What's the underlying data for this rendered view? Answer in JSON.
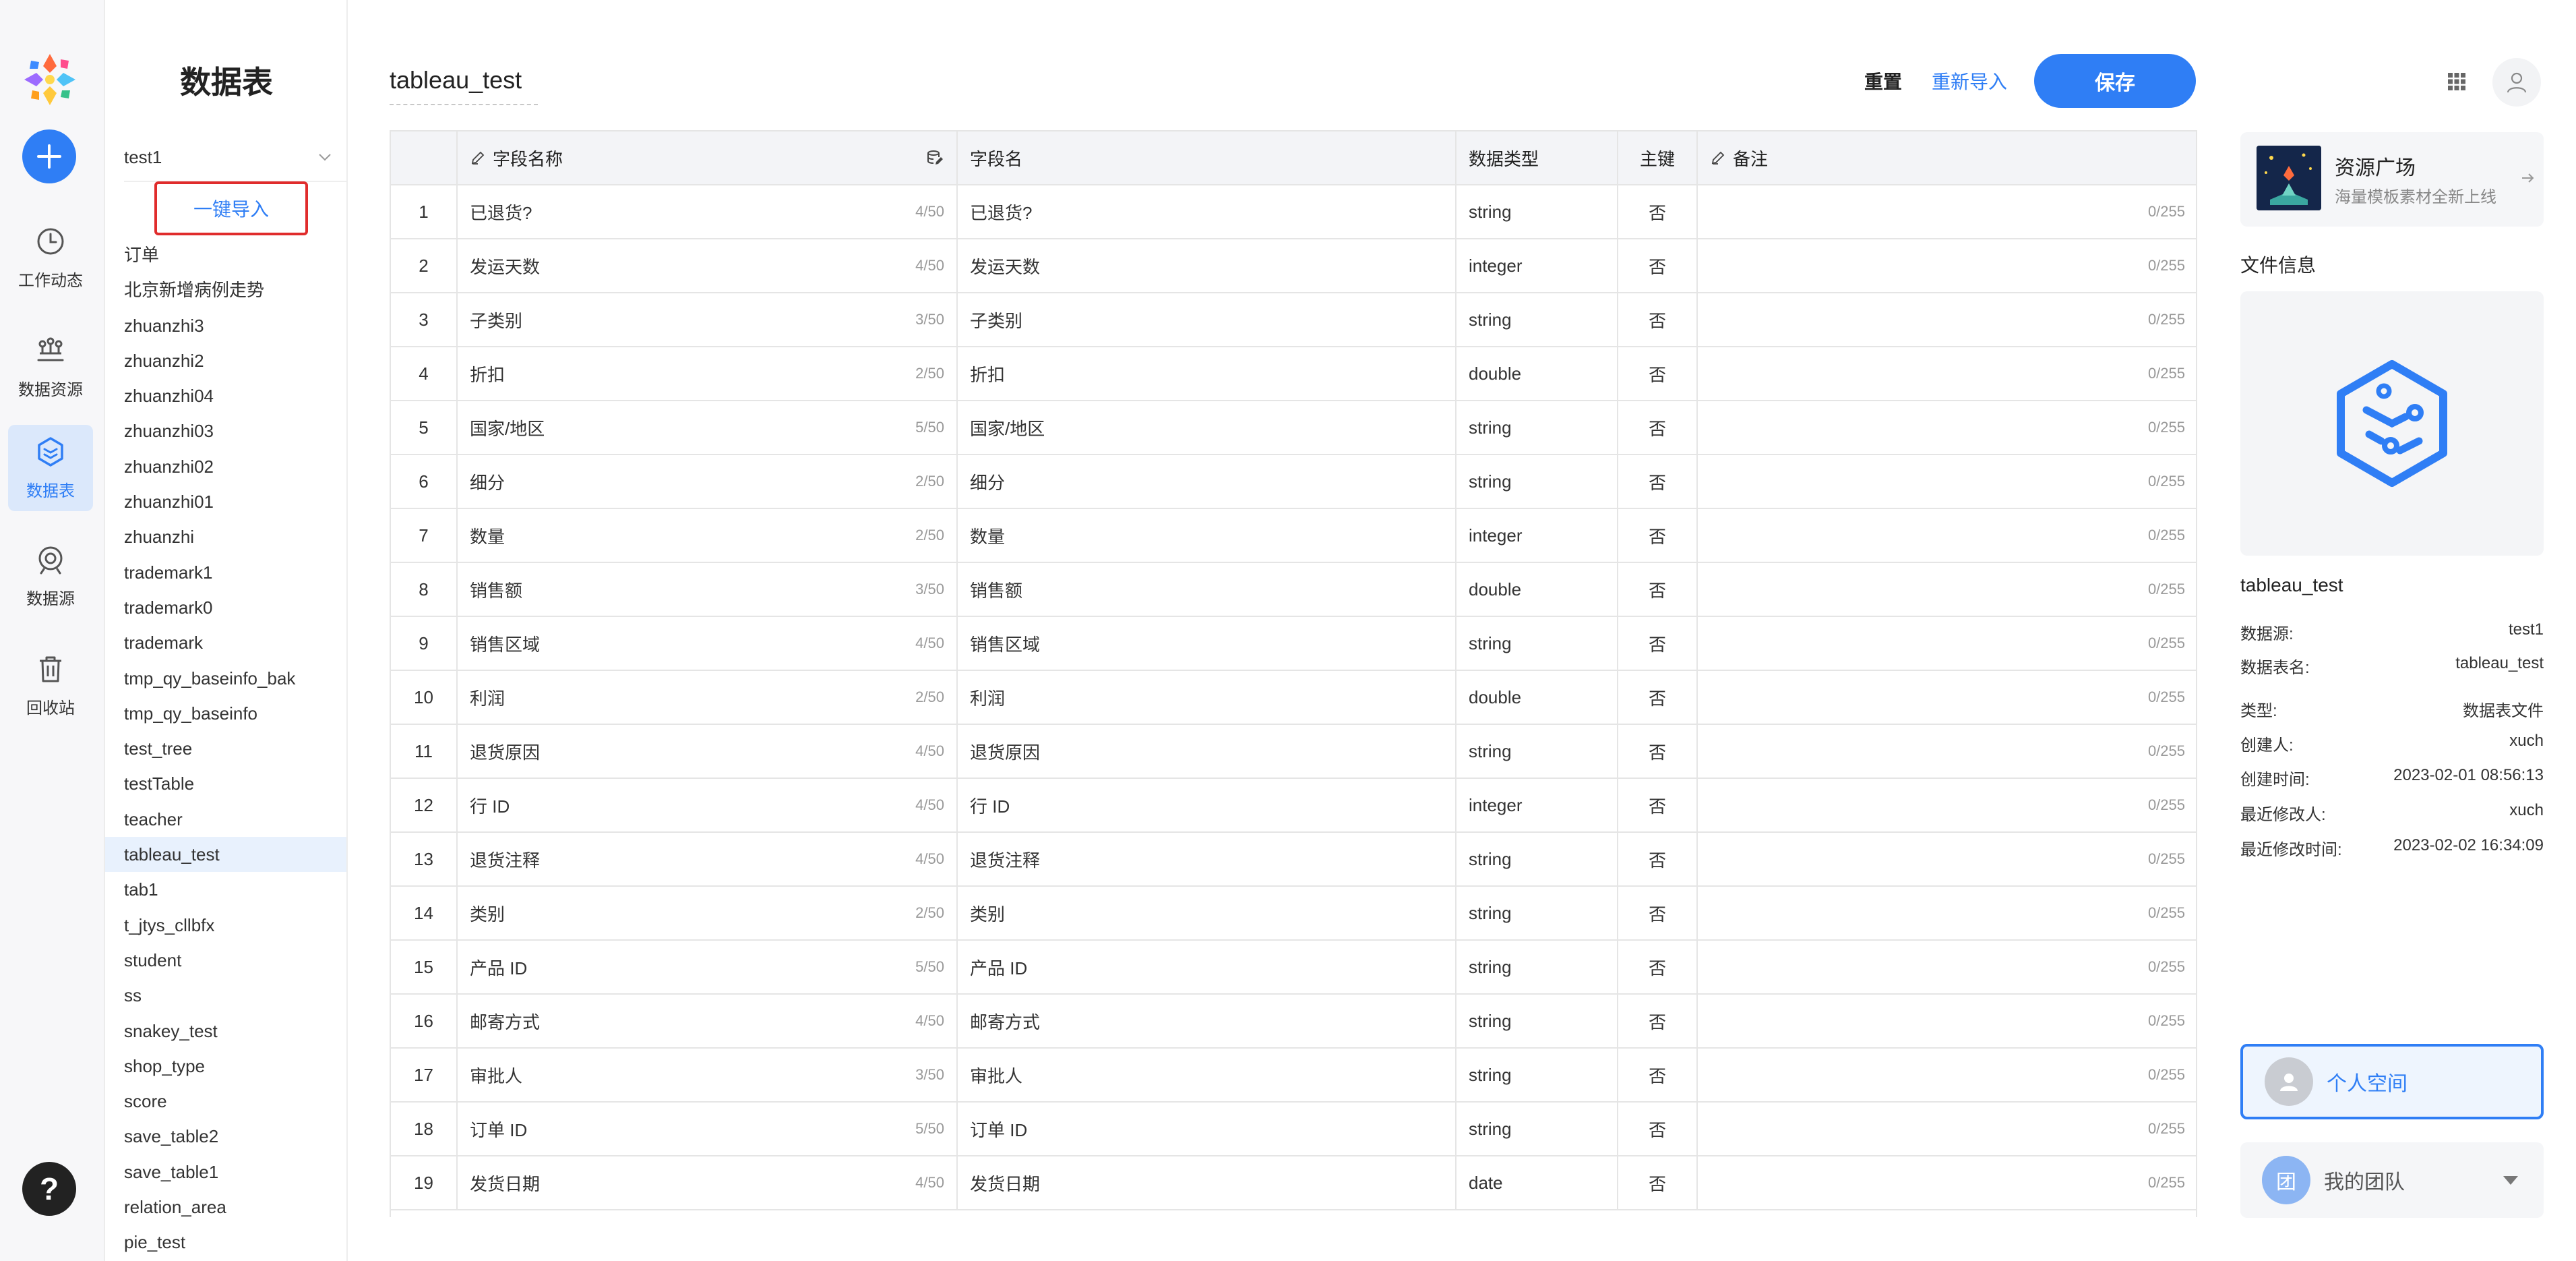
{
  "sidebar": {
    "items": [
      {
        "label": "工作动态",
        "icon": "clock-icon"
      },
      {
        "label": "数据资源",
        "icon": "data-resource-icon"
      },
      {
        "label": "数据表",
        "icon": "data-table-icon",
        "active": true
      },
      {
        "label": "数据源",
        "icon": "data-source-icon"
      },
      {
        "label": "回收站",
        "icon": "trash-icon"
      }
    ],
    "help_label": "?"
  },
  "list_panel": {
    "title": "数据表",
    "datasource": "test1",
    "import_button": "一键导入",
    "tables": [
      "订单",
      "北京新增病例走势",
      "zhuanzhi3",
      "zhuanzhi2",
      "zhuanzhi04",
      "zhuanzhi03",
      "zhuanzhi02",
      "zhuanzhi01",
      "zhuanzhi",
      "trademark1",
      "trademark0",
      "trademark",
      "tmp_qy_baseinfo_bak",
      "tmp_qy_baseinfo",
      "test_tree",
      "testTable",
      "teacher",
      "tableau_test",
      "tab1",
      "t_jtys_cllbfx",
      "student",
      "ss",
      "snakey_test",
      "shop_type",
      "score",
      "save_table2",
      "save_table1",
      "relation_area",
      "pie_test"
    ],
    "selected": "tableau_test"
  },
  "main": {
    "title": "tableau_test",
    "reset_label": "重置",
    "reimport_label": "重新导入",
    "save_label": "保存",
    "columns": {
      "field_name": "字段名称",
      "field_key": "字段名",
      "data_type": "数据类型",
      "primary_key": "主键",
      "remark": "备注"
    },
    "rows": [
      {
        "idx": "1",
        "name": "已退货?",
        "count": "4/50",
        "key": "已退货?",
        "type": "string",
        "pk": "否",
        "remark": "0/255"
      },
      {
        "idx": "2",
        "name": "发运天数",
        "count": "4/50",
        "key": "发运天数",
        "type": "integer",
        "pk": "否",
        "remark": "0/255"
      },
      {
        "idx": "3",
        "name": "子类别",
        "count": "3/50",
        "key": "子类别",
        "type": "string",
        "pk": "否",
        "remark": "0/255"
      },
      {
        "idx": "4",
        "name": "折扣",
        "count": "2/50",
        "key": "折扣",
        "type": "double",
        "pk": "否",
        "remark": "0/255"
      },
      {
        "idx": "5",
        "name": "国家/地区",
        "count": "5/50",
        "key": "国家/地区",
        "type": "string",
        "pk": "否",
        "remark": "0/255"
      },
      {
        "idx": "6",
        "name": "细分",
        "count": "2/50",
        "key": "细分",
        "type": "string",
        "pk": "否",
        "remark": "0/255"
      },
      {
        "idx": "7",
        "name": "数量",
        "count": "2/50",
        "key": "数量",
        "type": "integer",
        "pk": "否",
        "remark": "0/255"
      },
      {
        "idx": "8",
        "name": "销售额",
        "count": "3/50",
        "key": "销售额",
        "type": "double",
        "pk": "否",
        "remark": "0/255"
      },
      {
        "idx": "9",
        "name": "销售区域",
        "count": "4/50",
        "key": "销售区域",
        "type": "string",
        "pk": "否",
        "remark": "0/255"
      },
      {
        "idx": "10",
        "name": "利润",
        "count": "2/50",
        "key": "利润",
        "type": "double",
        "pk": "否",
        "remark": "0/255"
      },
      {
        "idx": "11",
        "name": "退货原因",
        "count": "4/50",
        "key": "退货原因",
        "type": "string",
        "pk": "否",
        "remark": "0/255"
      },
      {
        "idx": "12",
        "name": "行 ID",
        "count": "4/50",
        "key": "行 ID",
        "type": "integer",
        "pk": "否",
        "remark": "0/255"
      },
      {
        "idx": "13",
        "name": "退货注释",
        "count": "4/50",
        "key": "退货注释",
        "type": "string",
        "pk": "否",
        "remark": "0/255"
      },
      {
        "idx": "14",
        "name": "类别",
        "count": "2/50",
        "key": "类别",
        "type": "string",
        "pk": "否",
        "remark": "0/255"
      },
      {
        "idx": "15",
        "name": "产品 ID",
        "count": "5/50",
        "key": "产品 ID",
        "type": "string",
        "pk": "否",
        "remark": "0/255"
      },
      {
        "idx": "16",
        "name": "邮寄方式",
        "count": "4/50",
        "key": "邮寄方式",
        "type": "string",
        "pk": "否",
        "remark": "0/255"
      },
      {
        "idx": "17",
        "name": "审批人",
        "count": "3/50",
        "key": "审批人",
        "type": "string",
        "pk": "否",
        "remark": "0/255"
      },
      {
        "idx": "18",
        "name": "订单 ID",
        "count": "5/50",
        "key": "订单 ID",
        "type": "string",
        "pk": "否",
        "remark": "0/255"
      },
      {
        "idx": "19",
        "name": "发货日期",
        "count": "4/50",
        "key": "发货日期",
        "type": "date",
        "pk": "否",
        "remark": "0/255"
      }
    ]
  },
  "right_panel": {
    "resource_card": {
      "title": "资源广场",
      "subtitle": "海量模板素材全新上线"
    },
    "file_info_label": "文件信息",
    "file_name": "tableau_test",
    "meta": [
      {
        "label": "数据源:",
        "value": "test1"
      },
      {
        "label": "数据表名:",
        "value": "tableau_test"
      },
      {
        "label": "类型:",
        "value": "数据表文件"
      },
      {
        "label": "创建人:",
        "value": "xuch"
      },
      {
        "label": "创建时间:",
        "value": "2023-02-01 08:56:13"
      },
      {
        "label": "最近修改人:",
        "value": "xuch"
      },
      {
        "label": "最近修改时间:",
        "value": "2023-02-02 16:34:09"
      }
    ],
    "personal_space": "个人空间",
    "team_avatar": "团",
    "my_team": "我的团队"
  },
  "colors": {
    "accent": "#2f7ef5",
    "highlight_border": "#e02c2c",
    "selected_bg": "#e8f1fd",
    "header_bg": "#f3f4f7"
  }
}
